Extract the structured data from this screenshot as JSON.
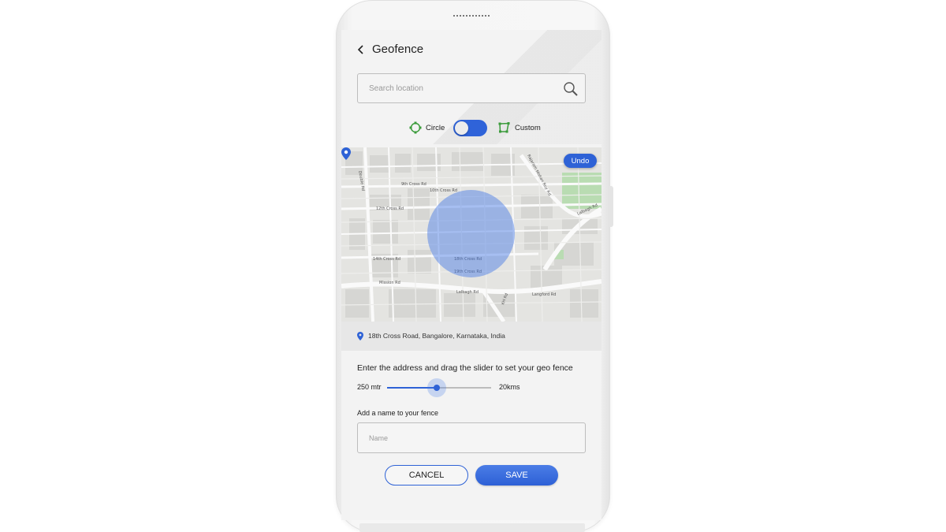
{
  "header": {
    "title": "Geofence",
    "back_icon": "chevron-left-icon"
  },
  "search": {
    "placeholder": "Search location",
    "value": "",
    "icon": "search-icon"
  },
  "shape_toggle": {
    "left_label": "Circle",
    "right_label": "Custom",
    "left_icon": "circle-target-icon",
    "right_icon": "polygon-icon",
    "selected": "Circle"
  },
  "map": {
    "undo_label": "Undo",
    "street_labels": [
      "9th Cross Rd",
      "10th Cross Rd",
      "12th Cross Rd",
      "14th Cross Rd",
      "18th Cross Rd",
      "19th Cross Rd",
      "Mission Rd",
      "Lalbagh Rd",
      "Langford Rd",
      "Lalbagh Rd",
      "KH Rd",
      "Rajaram Mohan Roy Rd",
      "Double Rd"
    ],
    "fence_shape": "circle",
    "pin_icon": "map-pin-icon"
  },
  "address": {
    "icon": "location-pin-icon",
    "text": "18th Cross Road, Bangalore, Karnataka, India"
  },
  "radius": {
    "instruction": "Enter the address and drag the slider to set your geo fence",
    "min_label": "250 mtr",
    "max_label": "20kms",
    "value_fraction": 0.48
  },
  "fence_name": {
    "label": "Add a name to your fence",
    "placeholder": "Name",
    "value": ""
  },
  "actions": {
    "cancel_label": "CANCEL",
    "save_label": "SAVE"
  },
  "colors": {
    "accent": "#2e62d6",
    "icon_green": "#3a9b3a",
    "fence_fill": "#4076e6"
  }
}
